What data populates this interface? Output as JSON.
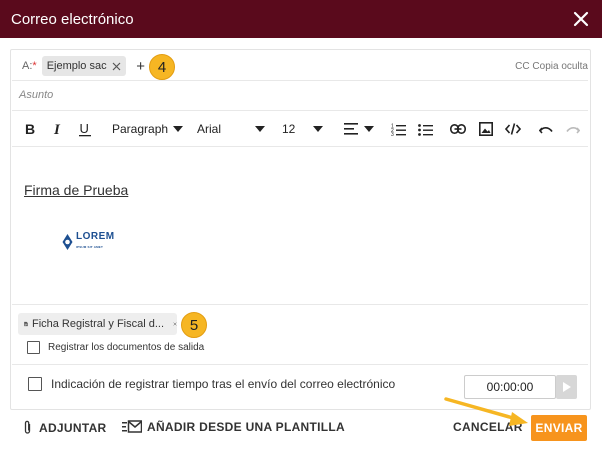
{
  "dialog": {
    "title": "Correo electrónico"
  },
  "recipients": {
    "to_label": "A:",
    "required_mark": "*",
    "chips": [
      {
        "label": "Ejemplo sac"
      }
    ],
    "add_label": "+",
    "cc_label": "CC",
    "bcc_label": "Copia oculta"
  },
  "callouts": {
    "first": "4",
    "second": "5"
  },
  "subject": {
    "placeholder": "Asunto"
  },
  "toolbar": {
    "paragraph_style": "Paragraph",
    "font_family": "Arial",
    "font_size": "12"
  },
  "editor": {
    "signature": "Firma de Prueba",
    "logo_text": "LOREM",
    "logo_subtext": "IPSUM SIT AMET"
  },
  "attachments": [
    {
      "name": "Ficha Registral y Fiscal d..."
    }
  ],
  "options": {
    "register_output_docs": "Registrar los documentos de salida",
    "register_time_after_send": "Indicación de registrar tiempo tras el envío del correo electrónico",
    "time_value": "00:00:00"
  },
  "footer": {
    "attach_label": "ADJUNTAR",
    "template_label": "AÑADIR DESDE UNA PLANTILLA",
    "cancel_label": "CANCELAR",
    "send_label": "ENVIAR"
  },
  "colors": {
    "titlebar": "#5a0a1c",
    "accent": "#f7941d",
    "callout": "#f6b623",
    "logo": "#1d4f91"
  },
  "icons": [
    "close-icon",
    "chip-close-icon",
    "bold-icon",
    "italic-icon",
    "underline-icon",
    "dropdown-icon",
    "align-icon",
    "ordered-list-icon",
    "bullet-list-icon",
    "link-icon",
    "image-icon",
    "code-icon",
    "undo-icon",
    "redo-icon",
    "document-icon",
    "paperclip-icon",
    "template-icon",
    "play-icon",
    "arrow-annotation-icon"
  ]
}
